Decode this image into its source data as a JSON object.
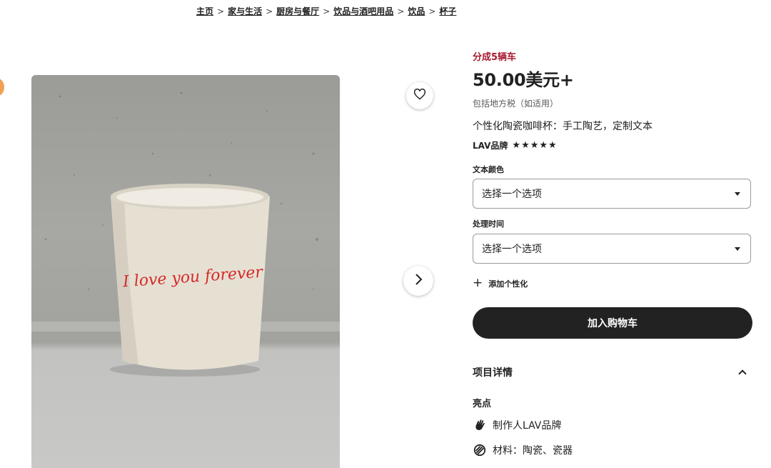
{
  "breadcrumb": {
    "items": [
      "主页",
      "家与生活",
      "厨房与餐厅",
      "饮品与酒吧用品",
      "饮品",
      "杯子"
    ],
    "separator": ">"
  },
  "gallery": {
    "mug_text": "I love you forever",
    "favorite_icon": "heart-icon",
    "next_icon": "chevron-right-icon"
  },
  "product": {
    "promo": "分成5辆车",
    "price": "50.00美元+",
    "tax_note": "包括地方税（如适用）",
    "title": "个性化陶瓷咖啡杯：手工陶艺，定制文本",
    "shop_name": "LAV品牌",
    "rating_stars": 5
  },
  "options": {
    "text_color_label": "文本颜色",
    "text_color_value": "选择一个选项",
    "processing_label": "处理时间",
    "processing_value": "选择一个选项",
    "add_personalization": "添加个性化"
  },
  "cart": {
    "button_label": "加入购物车"
  },
  "details": {
    "title": "项目详情",
    "highlights_title": "亮点",
    "maker": "制作人LAV品牌",
    "material": "材料：陶瓷、瓷器"
  },
  "colors": {
    "promo": "#a61a2e",
    "button_bg": "#222222",
    "mug_text": "#d42a2a"
  }
}
